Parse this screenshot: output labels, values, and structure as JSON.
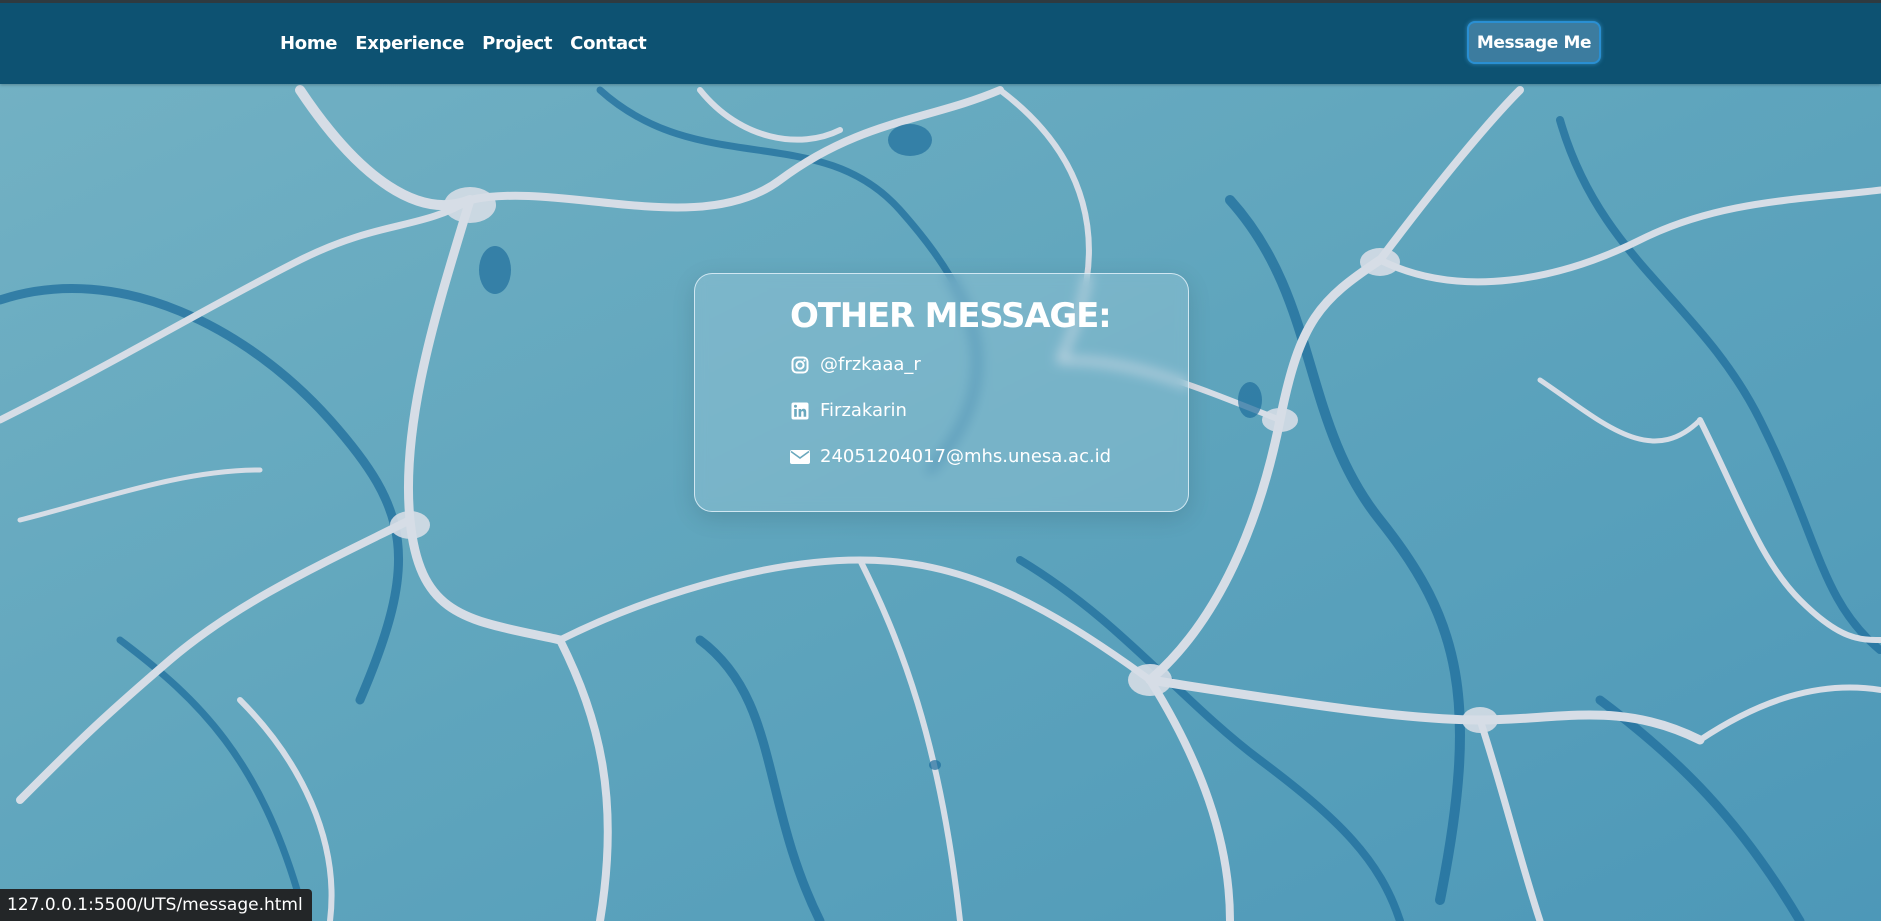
{
  "nav": {
    "links": [
      "Home",
      "Experience",
      "Project",
      "Contact"
    ],
    "cta_label": "Message Me"
  },
  "card": {
    "title": "OTHER MESSAGE:",
    "items": [
      {
        "icon": "instagram-icon",
        "text": "@frzkaaa_r"
      },
      {
        "icon": "linkedin-icon",
        "text": "Firzakarin"
      },
      {
        "icon": "envelope-icon",
        "text": "24051204017@mhs.unesa.ac.id"
      }
    ]
  },
  "status_bar": {
    "url": "127.0.0.1:5500/UTS/message.html"
  },
  "colors": {
    "navbar": "#0d5272",
    "cta_background": "#3c7c9f",
    "cta_border": "#2a8fd2",
    "background": "#5fa6bd",
    "vein_light": "#d6dde6",
    "vein_dark": "#1f6e9c",
    "text": "#ffffff"
  }
}
